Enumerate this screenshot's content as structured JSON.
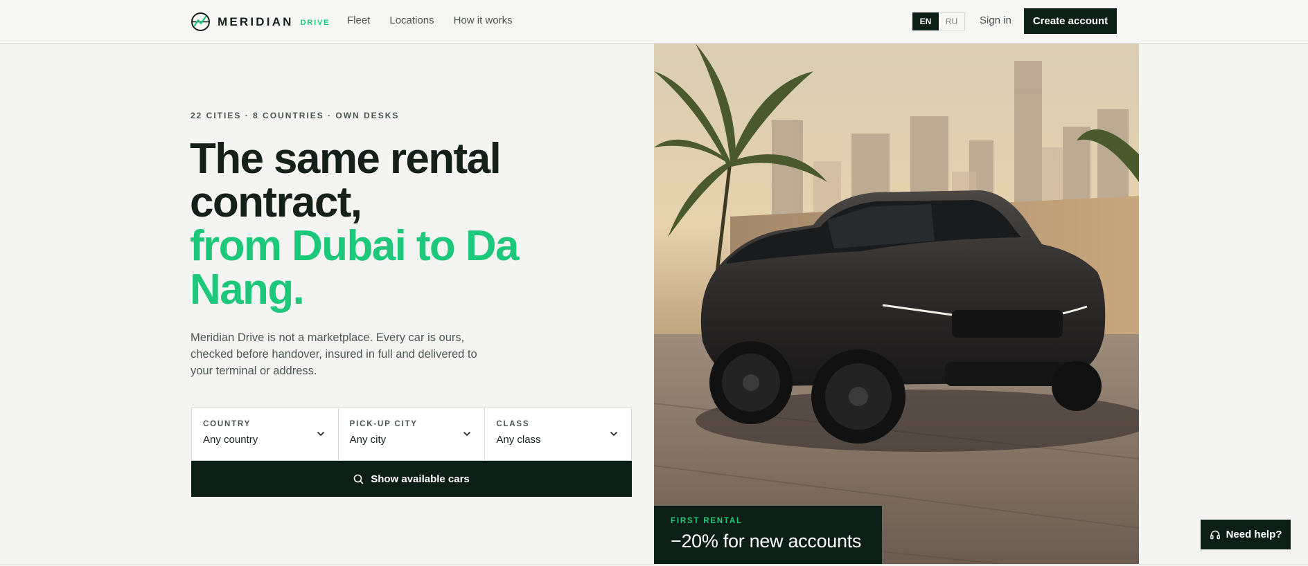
{
  "header": {
    "brand": "MERIDIAN",
    "brand_sub": "DRIVE",
    "nav": [
      "Fleet",
      "Locations",
      "How it works"
    ],
    "lang_active": "EN",
    "lang_other": "RU",
    "sign_in": "Sign in",
    "create_account": "Create account"
  },
  "hero": {
    "eyebrow": "22 CITIES · 8 COUNTRIES · OWN DESKS",
    "headline_main": "The same rental contract,",
    "headline_accent": "from Dubai to Da Nang.",
    "lede": "Meridian Drive is not a marketplace. Every car is ours, checked before handover, insured in full and delivered to your terminal or address."
  },
  "search": {
    "fields": [
      {
        "label": "COUNTRY",
        "value": "Any country"
      },
      {
        "label": "PICK-UP CITY",
        "value": "Any city"
      },
      {
        "label": "CLASS",
        "value": "Any class"
      }
    ],
    "button": "Show available cars"
  },
  "promo": {
    "label": "FIRST RENTAL",
    "text": "−20% for new accounts"
  },
  "help": "Need help?",
  "colors": {
    "accent": "#1ec87a",
    "dark": "#0c1f17",
    "background": "#f4f5f3"
  }
}
